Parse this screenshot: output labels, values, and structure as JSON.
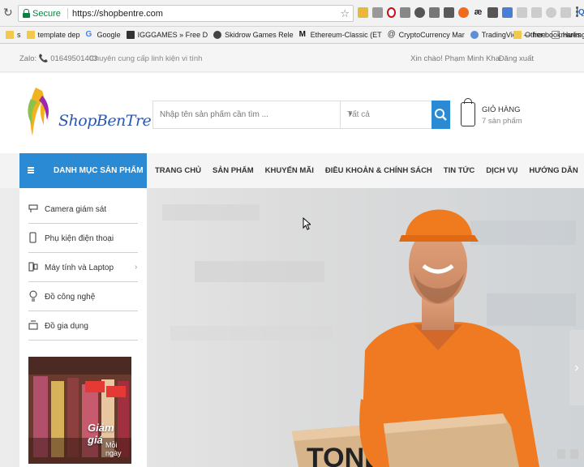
{
  "browser": {
    "secure_label": "Secure",
    "url": "https://shopbentre.com"
  },
  "bookmarks": {
    "items": [
      {
        "label": "s",
        "icon": "folder-icon"
      },
      {
        "label": "template dep",
        "icon": "folder-icon"
      },
      {
        "label": "Google",
        "icon": "google-icon"
      },
      {
        "label": "IGGGAMES » Free D",
        "icon": "iggames-icon"
      },
      {
        "label": "Skidrow Games Rele",
        "icon": "skull-icon"
      },
      {
        "label": "Ethereum-Classic (ET",
        "icon": "m-icon"
      },
      {
        "label": "CryptoCurrency Mar",
        "icon": "at-icon"
      },
      {
        "label": "TradingView — free",
        "icon": "tradingview-icon"
      },
      {
        "label": "Hướng dẫn sửa chữ",
        "icon": "page-icon"
      }
    ],
    "more": "»",
    "other": "Other bookmarks"
  },
  "topbar": {
    "zalo": "Zalo: 📞 01649501403",
    "slogan": "Chuyên cung cấp linh kiện vi tính",
    "greeting": "Xin chào! Phạm Minh Kha",
    "logout": "Đăng xuất"
  },
  "header": {
    "logo_text": "ShopBenTre.Com",
    "search_placeholder": "Nhập tên sản phẩm cần tìm ...",
    "category_selected": "Tất cả",
    "cart_title": "GIỎ HÀNG",
    "cart_count": "7 sản phẩm"
  },
  "nav": {
    "category_button": "DANH MỤC SẢN PHẨM",
    "links": [
      "TRANG CHỦ",
      "SẢN PHẨM",
      "KHUYẾN MÃI",
      "ĐIỀU KHOẢN & CHÍNH SÁCH",
      "TIN TỨC",
      "DỊCH VỤ",
      "HƯỚNG DẪN"
    ]
  },
  "categories": [
    {
      "label": "Camera giám sát",
      "icon": "camera-icon"
    },
    {
      "label": "Phụ kiện điện thoại",
      "icon": "phone-icon"
    },
    {
      "label": "Máy tính và Laptop",
      "icon": "computer-icon",
      "arrow": "›"
    },
    {
      "label": "Đồ công nghệ",
      "icon": "bulb-icon"
    },
    {
      "label": "Đồ gia dụng",
      "icon": "appliance-icon"
    }
  ],
  "promo": {
    "title": "Giảm giá",
    "subtitle": "Mỗi ngày"
  },
  "hero": {
    "box_text": "TONE",
    "next_arrow": "›"
  }
}
